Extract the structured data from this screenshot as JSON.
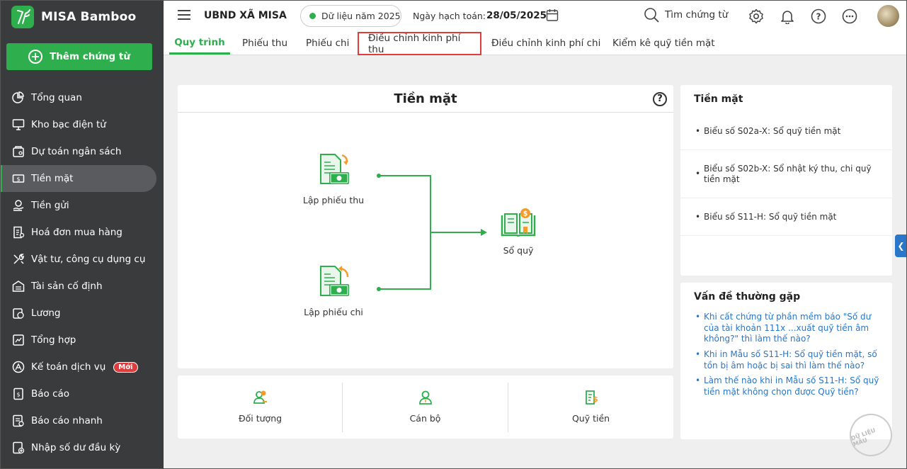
{
  "brand": {
    "name": "MISA Bamboo"
  },
  "sidebar": {
    "add_button": "Thêm chứng từ",
    "items": [
      {
        "label": "Tổng quan",
        "icon": "pie-chart-icon"
      },
      {
        "label": "Kho bạc điện tử",
        "icon": "monitor-icon"
      },
      {
        "label": "Dự toán ngân sách",
        "icon": "budget-icon"
      },
      {
        "label": "Tiền mặt",
        "icon": "cash-icon",
        "active": true
      },
      {
        "label": "Tiền gửi",
        "icon": "deposit-icon"
      },
      {
        "label": "Hoá đơn mua hàng",
        "icon": "invoice-icon"
      },
      {
        "label": "Vật tư, công cụ dụng cụ",
        "icon": "tools-icon"
      },
      {
        "label": "Tài sản cố định",
        "icon": "building-icon"
      },
      {
        "label": "Lương",
        "icon": "salary-icon"
      },
      {
        "label": "Tổng hợp",
        "icon": "summary-icon"
      },
      {
        "label": "Kế toán dịch vụ",
        "icon": "service-icon",
        "badge": "Mới"
      },
      {
        "label": "Báo cáo",
        "icon": "report-icon"
      },
      {
        "label": "Báo cáo nhanh",
        "icon": "quick-report-icon"
      },
      {
        "label": "Nhập số dư đầu kỳ",
        "icon": "opening-balance-icon"
      }
    ]
  },
  "topbar": {
    "org": "UBND XÃ MISA",
    "data_year": "Dữ liệu năm 2025",
    "date_label": "Ngày hạch toán:",
    "date_value": "28/05/2025",
    "search": "Tìm chứng từ"
  },
  "tabs": [
    "Quy trình",
    "Phiếu thu",
    "Phiếu chi",
    "Điều chỉnh kinh phí thu",
    "Điều chỉnh kinh phí chi",
    "Kiểm kê quỹ tiền mặt"
  ],
  "flow": {
    "title": "Tiền mặt",
    "help": "?",
    "nodes": {
      "receipt": "Lập phiếu thu",
      "payment": "Lập phiếu chi",
      "ledger": "Sổ quỹ"
    }
  },
  "quick": {
    "partner": "Đối tượng",
    "staff": "Cán bộ",
    "fund": "Quỹ tiền"
  },
  "reports": {
    "title": "Tiền mặt",
    "items": [
      "Biểu số S02a-X: Sổ quỹ tiền mặt",
      "Biểu số S02b-X: Sổ nhật ký thu, chi quỹ tiền mặt",
      "Biểu số S11-H: Sổ quỹ tiền mặt"
    ]
  },
  "faq": {
    "title": "Vấn đề thường gặp",
    "items": [
      "Khi cất chứng từ phần mềm báo \"Số dư của tài khoản 111x ...xuất quỹ tiền âm không?\" thì làm thế nào?",
      "Khi in Mẫu số S11-H: Sổ quỹ tiền mặt, số tồn bị âm hoặc bị sai thì làm thế nào?",
      "Làm thế nào khi in Mẫu số S11-H: Sổ quỹ tiền mặt không chọn được Quỹ tiền?"
    ]
  },
  "watermark": "DỮ LIỆU MẪU",
  "colors": {
    "accent": "#2fae4e",
    "sidebar": "#3a3b3d",
    "link": "#2a76c8",
    "highlight": "#e23b3b",
    "coin": "#f39c2b"
  }
}
